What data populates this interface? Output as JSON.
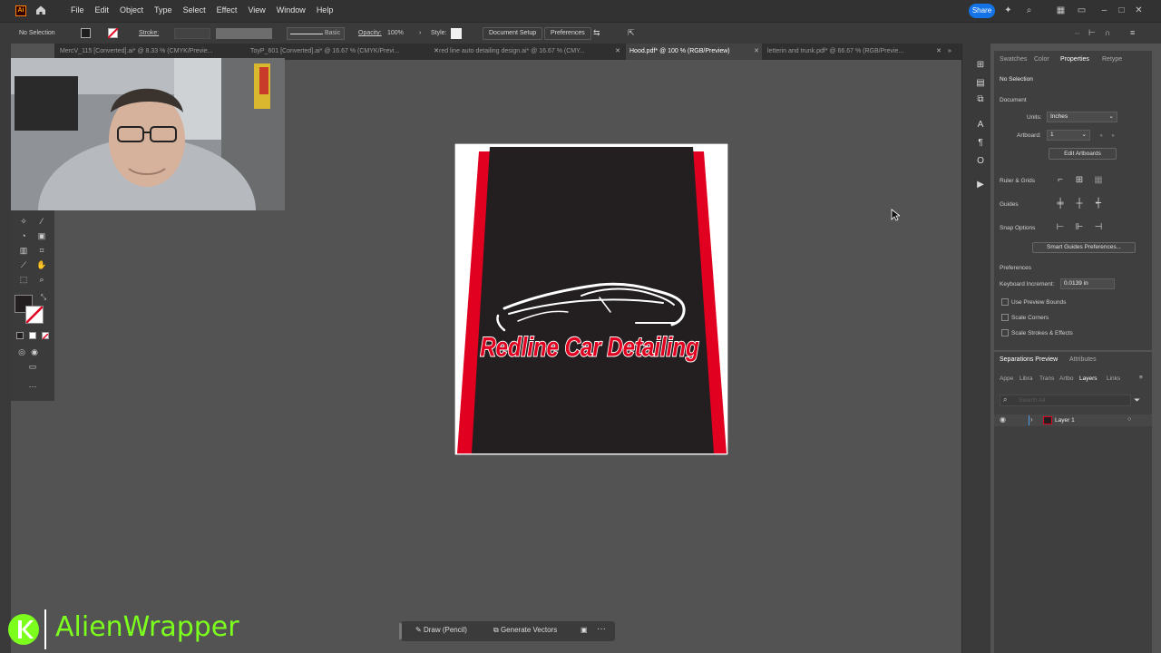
{
  "app": {
    "logo_text": "Ai",
    "menu": [
      "File",
      "Edit",
      "Object",
      "Type",
      "Select",
      "Effect",
      "View",
      "Window",
      "Help"
    ],
    "share_label": "Share"
  },
  "control_bar": {
    "selection": "No Selection",
    "stroke_label": "Stroke:",
    "stroke_style": "Basic",
    "opacity_label": "Opacity:",
    "opacity_value": "100%",
    "style_label": "Style:",
    "document_setup": "Document Setup",
    "preferences": "Preferences"
  },
  "tabs": [
    {
      "label": "MercV_115 [Converted].ai* @ 8.33 % (CMYK/Previe...",
      "active": false
    },
    {
      "label": "ToyP_601 [Converted].ai* @ 16.67 % (CMYK/Previ...",
      "active": false
    },
    {
      "label": "red line auto detailing design.ai* @ 16.67 % (CMY...",
      "active": false
    },
    {
      "label": "Hood.pdf* @ 100 % (RGB/Preview)",
      "active": true
    },
    {
      "label": "letterin and trunk.pdf* @ 66.67 % (RGB/Previe...",
      "active": false
    }
  ],
  "artboard": {
    "brand_text": "Redline Car Detailing",
    "colors": {
      "red": "#e1001f",
      "dark": "#231f20",
      "white": "#ffffff"
    }
  },
  "properties": {
    "tabs": [
      "Swatches",
      "Color",
      "Properties",
      "Retype"
    ],
    "active_tab": "Properties",
    "selection": "No Selection",
    "document_heading": "Document",
    "units_label": "Units:",
    "units_value": "Inches",
    "artboard_label": "Artboard:",
    "artboard_value": "1",
    "edit_artboards": "Edit Artboards",
    "ruler_grids": "Ruler & Grids",
    "guides": "Guides",
    "snap_options": "Snap Options",
    "smart_guides_btn": "Smart Guides Preferences...",
    "preferences_heading": "Preferences",
    "keyboard_increment_label": "Keyboard Increment:",
    "keyboard_increment_value": "0.0139 in",
    "use_preview_bounds": "Use Preview Bounds",
    "scale_corners": "Scale Corners",
    "scale_strokes": "Scale Strokes & Effects"
  },
  "layers_panel": {
    "top_tabs": [
      "Separations Preview",
      "Attributes"
    ],
    "tabs": [
      "Appe",
      "Libra",
      "Trans",
      "Artbo",
      "Layers",
      "Links"
    ],
    "active_tab": "Layers",
    "search_placeholder": "Search All",
    "layer_name": "Layer 1"
  },
  "bottom_bar": {
    "draw_label": "Draw (Pencil)",
    "generate_label": "Generate Vectors"
  },
  "watermark": {
    "name": "AlienWrapper",
    "color": "#7dff1e"
  }
}
